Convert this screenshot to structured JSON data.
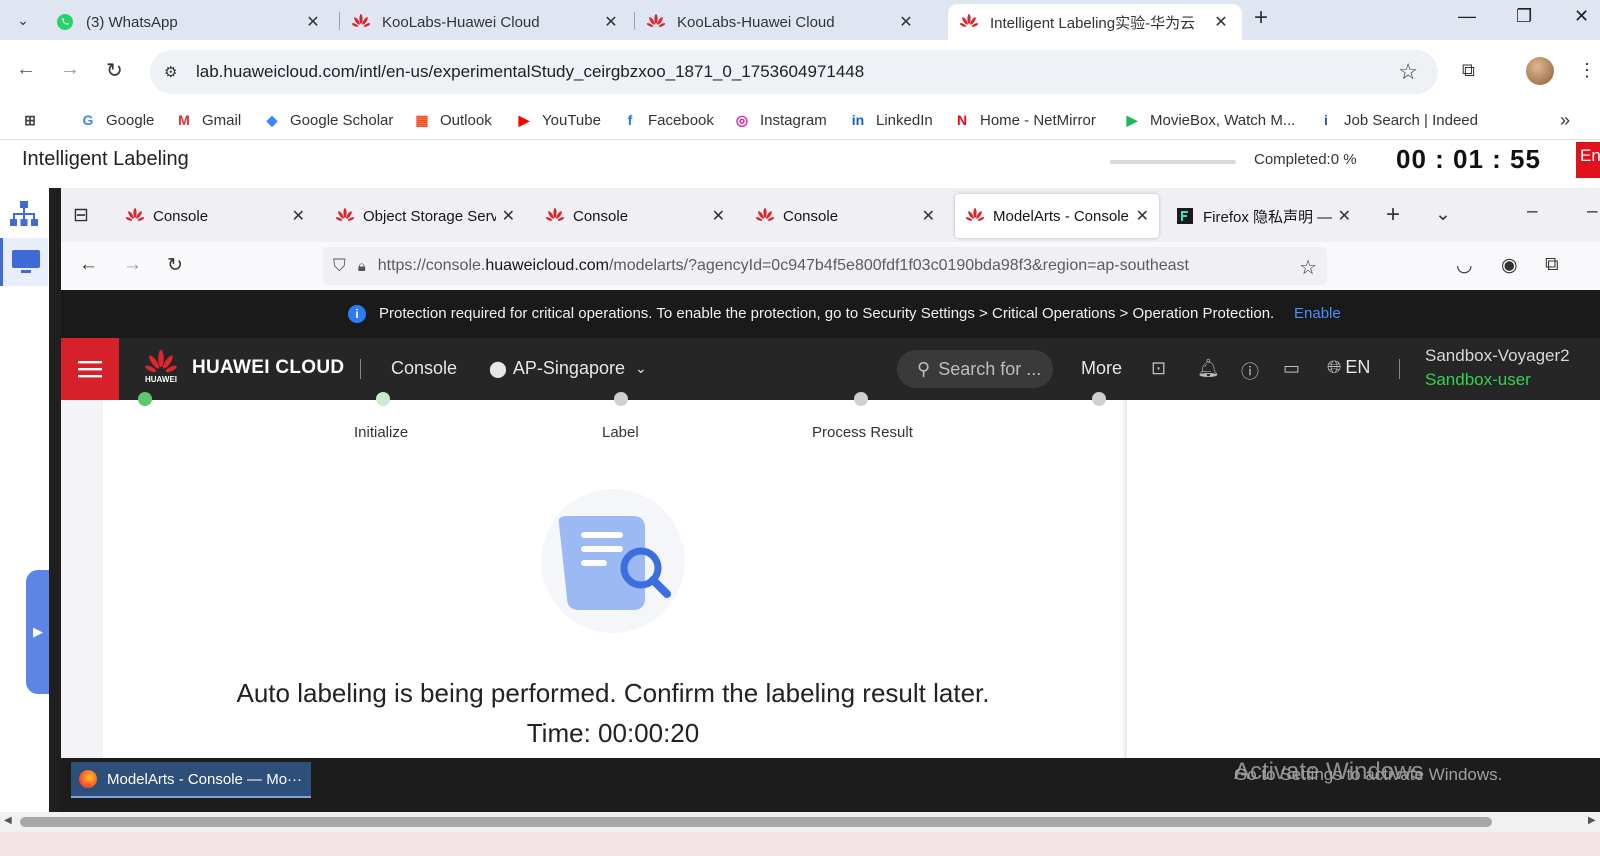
{
  "chrome": {
    "tabs": [
      {
        "label": "(3) WhatsApp",
        "icon": "whatsapp-icon"
      },
      {
        "label": "KooLabs-Huawei Cloud",
        "icon": "huawei-icon"
      },
      {
        "label": "KooLabs-Huawei Cloud",
        "icon": "huawei-icon"
      },
      {
        "label": "Intelligent Labeling实验-华为云",
        "icon": "huawei-icon"
      }
    ],
    "url": "lab.huaweicloud.com/intl/en-us/experimentalStudy_ceirgbzxoo_1871_0_1753604971448",
    "bookmarks": [
      {
        "label": "Google",
        "icon": "G",
        "color": "#4285f4"
      },
      {
        "label": "Gmail",
        "icon": "M",
        "color": "#d93025"
      },
      {
        "label": "Google Scholar",
        "icon": "◆",
        "color": "#4285f4"
      },
      {
        "label": "Outlook",
        "icon": "▦",
        "color": "#f25022"
      },
      {
        "label": "YouTube",
        "icon": "▶",
        "color": "#ff0000"
      },
      {
        "label": "Facebook",
        "icon": "f",
        "color": "#1877f2"
      },
      {
        "label": "Instagram",
        "icon": "◎",
        "color": "#d6249f"
      },
      {
        "label": "LinkedIn",
        "icon": "in",
        "color": "#0a66c2"
      },
      {
        "label": "Home - NetMirror",
        "icon": "N",
        "color": "#e50914"
      },
      {
        "label": "MovieBox, Watch M...",
        "icon": "▶",
        "color": "#1db954"
      },
      {
        "label": "Job Search | Indeed",
        "icon": "i",
        "color": "#2557a7"
      }
    ]
  },
  "lab": {
    "title": "Intelligent Labeling",
    "completed": "Completed:0 %",
    "timer": "00 : 01 : 55",
    "end_label": "En"
  },
  "firefox": {
    "tabs": [
      {
        "label": "Console"
      },
      {
        "label": "Object Storage Serv"
      },
      {
        "label": "Console"
      },
      {
        "label": "Console"
      },
      {
        "label": "ModelArts - Console"
      },
      {
        "label": "Firefox 隐私声明 —"
      }
    ],
    "url_prefix": "https://console.",
    "url_domain": "huaweicloud.com",
    "url_rest": "/modelarts/?agencyId=0c947b4f5e800fdf1f03c0190bda98f3&region=ap-southeast"
  },
  "notice": {
    "message": "Protection required for critical operations. To enable the protection, go to Security Settings > Critical Operations > Operation Protection.",
    "link": "Enable"
  },
  "huawei_nav": {
    "logo_text": "HUAWEI",
    "brand": "HUAWEI CLOUD",
    "console": "Console",
    "region": "AP-Singapore",
    "search_placeholder": "Search for ...",
    "more": "More",
    "language": "EN",
    "user": "Sandbox-Voyager2",
    "user_role": "Sandbox-user"
  },
  "steps": [
    "Initialize",
    "Label",
    "Process Result"
  ],
  "status": {
    "message": "Auto labeling is being performed. Confirm the labeling result later.",
    "time": "Time: 00:00:20"
  },
  "taskbar": {
    "item": "ModelArts - Console — Mo···"
  },
  "watermark": {
    "line1": "Activate Windows",
    "line2": "Go to Settings to activate Windows."
  }
}
